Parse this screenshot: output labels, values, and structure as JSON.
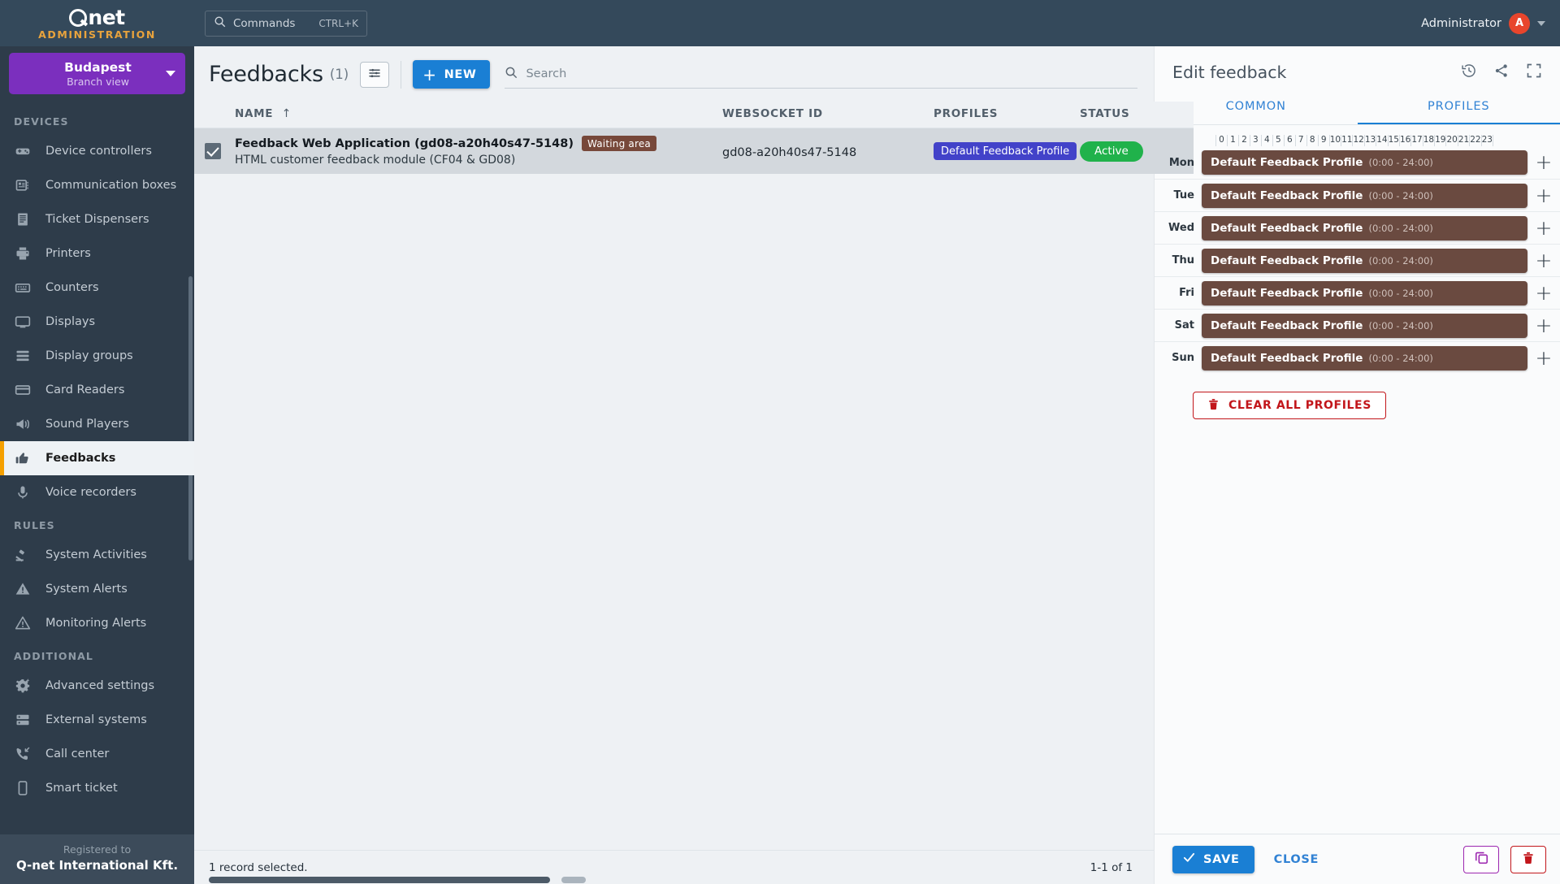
{
  "topbar": {
    "logo_text": "net",
    "logo_sub": "ADMINISTRATION",
    "command_label": "Commands",
    "command_shortcut": "CTRL+K",
    "user_name": "Administrator",
    "user_initial": "A"
  },
  "sidebar": {
    "branch": {
      "name": "Budapest",
      "sub": "Branch view"
    },
    "sections": [
      {
        "title": "DEVICES",
        "items": [
          {
            "label": "Device controllers",
            "icon": "device-controller-icon"
          },
          {
            "label": "Communication boxes",
            "icon": "comm-box-icon"
          },
          {
            "label": "Ticket Dispensers",
            "icon": "ticket-dispenser-icon"
          },
          {
            "label": "Printers",
            "icon": "printer-icon"
          },
          {
            "label": "Counters",
            "icon": "counter-icon"
          },
          {
            "label": "Displays",
            "icon": "display-icon"
          },
          {
            "label": "Display groups",
            "icon": "display-groups-icon"
          },
          {
            "label": "Card Readers",
            "icon": "card-reader-icon"
          },
          {
            "label": "Sound Players",
            "icon": "sound-player-icon"
          },
          {
            "label": "Feedbacks",
            "icon": "thumbs-up-icon",
            "active": true
          },
          {
            "label": "Voice recorders",
            "icon": "microphone-icon"
          }
        ]
      },
      {
        "title": "RULES",
        "items": [
          {
            "label": "System Activities",
            "icon": "gavel-icon"
          },
          {
            "label": "System Alerts",
            "icon": "warning-filled-icon"
          },
          {
            "label": "Monitoring Alerts",
            "icon": "warning-outline-icon"
          }
        ]
      },
      {
        "title": "ADDITIONAL",
        "items": [
          {
            "label": "Advanced settings",
            "icon": "gear-sparkle-icon"
          },
          {
            "label": "External systems",
            "icon": "server-icon"
          },
          {
            "label": "Call center",
            "icon": "phone-incoming-icon"
          },
          {
            "label": "Smart ticket",
            "icon": "smartphone-icon"
          }
        ]
      }
    ],
    "registered": {
      "label": "Registered to",
      "company": "Q-net International Kft."
    }
  },
  "main": {
    "title": "Feedbacks",
    "count": "(1)",
    "new_label": "NEW",
    "search_placeholder": "Search",
    "columns": [
      "NAME",
      "WEBSOCKET ID",
      "PROFILES",
      "STATUS"
    ],
    "sort_column": "NAME",
    "sort_arrow": "↑",
    "rows": [
      {
        "checked": true,
        "name": "Feedback Web Application (gd08-a20h40s47-5148)",
        "tag": "Waiting area",
        "description": "HTML customer feedback module (CF04 & GD08)",
        "websocket_id": "gd08-a20h40s47-5148",
        "profile": "Default Feedback Profile",
        "status": "Active"
      }
    ],
    "footer_left": "1 record selected.",
    "footer_right": "1-1 of 1"
  },
  "panel": {
    "title": "Edit feedback",
    "header_icons": [
      "history-icon",
      "share-icon",
      "fullscreen-icon"
    ],
    "tabs": [
      {
        "label": "COMMON",
        "active": false
      },
      {
        "label": "PROFILES",
        "active": true
      }
    ],
    "hours": [
      "0",
      "1",
      "2",
      "3",
      "4",
      "5",
      "6",
      "7",
      "8",
      "9",
      "10",
      "11",
      "12",
      "13",
      "14",
      "15",
      "16",
      "17",
      "18",
      "19",
      "20",
      "21",
      "22",
      "23"
    ],
    "days": [
      {
        "label": "Mon",
        "profile": "Default Feedback Profile",
        "time": "(0:00 - 24:00)"
      },
      {
        "label": "Tue",
        "profile": "Default Feedback Profile",
        "time": "(0:00 - 24:00)"
      },
      {
        "label": "Wed",
        "profile": "Default Feedback Profile",
        "time": "(0:00 - 24:00)"
      },
      {
        "label": "Thu",
        "profile": "Default Feedback Profile",
        "time": "(0:00 - 24:00)"
      },
      {
        "label": "Fri",
        "profile": "Default Feedback Profile",
        "time": "(0:00 - 24:00)"
      },
      {
        "label": "Sat",
        "profile": "Default Feedback Profile",
        "time": "(0:00 - 24:00)"
      },
      {
        "label": "Sun",
        "profile": "Default Feedback Profile",
        "time": "(0:00 - 24:00)"
      }
    ],
    "add_symbol": "+",
    "clear_all_label": "CLEAR ALL PROFILES",
    "save_label": "SAVE",
    "close_label": "CLOSE"
  },
  "colors": {
    "topbar_bg": "#34495b",
    "sidebar_bg": "#2e3c4a",
    "branch_purple": "#7b2fbe",
    "accent_orange": "#e8a33d",
    "primary_blue": "#1a7fd4",
    "active_green": "#20b24b",
    "profile_chip": "#4242c9",
    "waiting_tag": "#77483a",
    "profile_bar": "#6a4a40",
    "danger_red": "#c2161b",
    "copy_purple": "#9c27b0"
  }
}
